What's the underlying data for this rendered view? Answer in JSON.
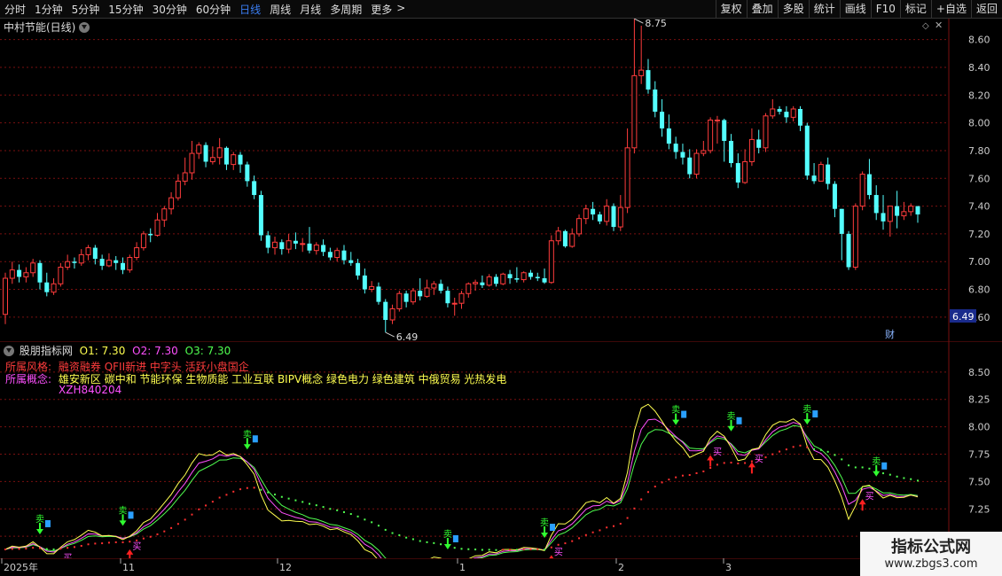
{
  "toolbar": {
    "periods": [
      "分时",
      "1分钟",
      "5分钟",
      "15分钟",
      "30分钟",
      "60分钟",
      "日线",
      "周线",
      "月线",
      "多周期",
      "更多"
    ],
    "active_index": 6,
    "more_arrow": ">",
    "right_buttons": [
      "复权",
      "叠加",
      "多股",
      "统计",
      "画线",
      "F10",
      "标记",
      "+自选",
      "返回"
    ]
  },
  "main_panel": {
    "title": "中村节能(日线)",
    "price_axis": [
      "8.60",
      "8.40",
      "8.20",
      "8.00",
      "7.80",
      "7.60",
      "7.40",
      "7.20",
      "7.00",
      "6.80",
      "6.60"
    ],
    "current_price": "6.49",
    "high_label": "8.75",
    "low_label": "6.49",
    "cai_badge": "财",
    "colors": {
      "up": "#ff3c3c",
      "down": "#54ffff",
      "grid": "#7a1010"
    },
    "candles": [
      [
        6.62,
        6.88,
        6.92,
        6.55
      ],
      [
        6.88,
        6.94,
        7.0,
        6.84
      ],
      [
        6.94,
        6.89,
        6.98,
        6.85
      ],
      [
        6.89,
        6.92,
        6.96,
        6.85
      ],
      [
        6.92,
        6.99,
        7.02,
        6.89
      ],
      [
        6.99,
        6.85,
        7.01,
        6.8
      ],
      [
        6.85,
        6.78,
        6.92,
        6.75
      ],
      [
        6.78,
        6.84,
        6.88,
        6.76
      ],
      [
        6.84,
        6.96,
        6.99,
        6.82
      ],
      [
        6.96,
        7.0,
        7.05,
        6.94
      ],
      [
        7.0,
        6.99,
        7.03,
        6.95
      ],
      [
        6.99,
        7.05,
        7.09,
        6.97
      ],
      [
        7.05,
        7.1,
        7.12,
        7.01
      ],
      [
        7.1,
        7.02,
        7.12,
        6.98
      ],
      [
        7.02,
        6.97,
        7.05,
        6.94
      ],
      [
        6.97,
        7.01,
        7.06,
        6.96
      ],
      [
        7.01,
        6.99,
        7.04,
        6.94
      ],
      [
        6.99,
        6.94,
        7.03,
        6.91
      ],
      [
        6.94,
        7.03,
        7.05,
        6.92
      ],
      [
        7.03,
        7.1,
        7.14,
        7.01
      ],
      [
        7.1,
        7.2,
        7.22,
        7.08
      ],
      [
        7.2,
        7.19,
        7.24,
        7.14
      ],
      [
        7.19,
        7.3,
        7.35,
        7.18
      ],
      [
        7.3,
        7.38,
        7.4,
        7.25
      ],
      [
        7.38,
        7.46,
        7.5,
        7.34
      ],
      [
        7.46,
        7.58,
        7.63,
        7.44
      ],
      [
        7.58,
        7.64,
        7.75,
        7.55
      ],
      [
        7.64,
        7.78,
        7.87,
        7.59
      ],
      [
        7.78,
        7.84,
        7.86,
        7.74
      ],
      [
        7.84,
        7.72,
        7.86,
        7.68
      ],
      [
        7.72,
        7.75,
        7.83,
        7.7
      ],
      [
        7.75,
        7.82,
        7.89,
        7.7
      ],
      [
        7.82,
        7.7,
        7.83,
        7.66
      ],
      [
        7.7,
        7.77,
        7.79,
        7.66
      ],
      [
        7.77,
        7.7,
        7.79,
        7.64
      ],
      [
        7.7,
        7.58,
        7.72,
        7.54
      ],
      [
        7.58,
        7.48,
        7.62,
        7.45
      ],
      [
        7.48,
        7.19,
        7.51,
        7.15
      ],
      [
        7.19,
        7.1,
        7.22,
        7.06
      ],
      [
        7.1,
        7.14,
        7.18,
        7.05
      ],
      [
        7.14,
        7.09,
        7.16,
        7.05
      ],
      [
        7.09,
        7.15,
        7.2,
        7.06
      ],
      [
        7.15,
        7.13,
        7.21,
        7.09
      ],
      [
        7.13,
        7.13,
        7.17,
        7.07
      ],
      [
        7.13,
        7.08,
        7.25,
        7.06
      ],
      [
        7.08,
        7.12,
        7.14,
        7.05
      ],
      [
        7.12,
        7.07,
        7.16,
        7.04
      ],
      [
        7.07,
        7.03,
        7.1,
        7.01
      ],
      [
        7.03,
        7.08,
        7.1,
        7.0
      ],
      [
        7.08,
        7.01,
        7.12,
        6.98
      ],
      [
        7.01,
        6.99,
        7.07,
        6.97
      ],
      [
        6.99,
        6.9,
        7.02,
        6.87
      ],
      [
        6.9,
        6.8,
        6.95,
        6.77
      ],
      [
        6.8,
        6.82,
        6.86,
        6.78
      ],
      [
        6.82,
        6.71,
        6.85,
        6.69
      ],
      [
        6.71,
        6.58,
        6.73,
        6.49
      ],
      [
        6.58,
        6.66,
        6.69,
        6.55
      ],
      [
        6.66,
        6.77,
        6.79,
        6.64
      ],
      [
        6.77,
        6.71,
        6.79,
        6.67
      ],
      [
        6.71,
        6.79,
        6.81,
        6.69
      ],
      [
        6.79,
        6.75,
        6.88,
        6.72
      ],
      [
        6.75,
        6.81,
        6.87,
        6.74
      ],
      [
        6.81,
        6.84,
        6.86,
        6.76
      ],
      [
        6.84,
        6.79,
        6.87,
        6.77
      ],
      [
        6.79,
        6.7,
        6.82,
        6.67
      ],
      [
        6.7,
        6.7,
        6.74,
        6.61
      ],
      [
        6.7,
        6.77,
        6.79,
        6.66
      ],
      [
        6.77,
        6.84,
        6.85,
        6.74
      ],
      [
        6.84,
        6.85,
        6.87,
        6.79
      ],
      [
        6.85,
        6.83,
        6.9,
        6.81
      ],
      [
        6.83,
        6.89,
        6.91,
        6.82
      ],
      [
        6.89,
        6.84,
        6.91,
        6.82
      ],
      [
        6.84,
        6.91,
        6.92,
        6.83
      ],
      [
        6.91,
        6.88,
        6.94,
        6.84
      ],
      [
        6.88,
        6.87,
        6.96,
        6.85
      ],
      [
        6.87,
        6.92,
        6.93,
        6.85
      ],
      [
        6.92,
        6.89,
        6.94,
        6.87
      ],
      [
        6.89,
        6.88,
        6.92,
        6.86
      ],
      [
        6.88,
        6.85,
        6.95,
        6.84
      ],
      [
        6.85,
        7.15,
        7.19,
        6.84
      ],
      [
        7.15,
        7.22,
        7.25,
        7.12
      ],
      [
        7.22,
        7.11,
        7.23,
        7.1
      ],
      [
        7.11,
        7.2,
        7.24,
        7.1
      ],
      [
        7.2,
        7.31,
        7.34,
        7.18
      ],
      [
        7.31,
        7.38,
        7.41,
        7.27
      ],
      [
        7.38,
        7.34,
        7.43,
        7.3
      ],
      [
        7.34,
        7.29,
        7.36,
        7.27
      ],
      [
        7.29,
        7.4,
        7.45,
        7.26
      ],
      [
        7.4,
        7.25,
        7.42,
        7.22
      ],
      [
        7.25,
        7.39,
        7.48,
        7.22
      ],
      [
        7.39,
        7.82,
        7.96,
        7.35
      ],
      [
        7.82,
        8.34,
        8.75,
        7.78
      ],
      [
        8.34,
        8.38,
        8.7,
        8.28
      ],
      [
        8.38,
        8.24,
        8.46,
        8.21
      ],
      [
        8.24,
        8.08,
        8.3,
        8.04
      ],
      [
        8.08,
        7.96,
        8.17,
        7.9
      ],
      [
        7.96,
        7.85,
        8.06,
        7.81
      ],
      [
        7.85,
        7.79,
        7.9,
        7.74
      ],
      [
        7.79,
        7.75,
        7.85,
        7.7
      ],
      [
        7.75,
        7.63,
        7.81,
        7.6
      ],
      [
        7.63,
        7.78,
        7.81,
        7.6
      ],
      [
        7.78,
        7.8,
        7.87,
        7.76
      ],
      [
        7.8,
        8.02,
        8.04,
        7.78
      ],
      [
        8.02,
        8.02,
        8.05,
        7.85
      ],
      [
        8.02,
        7.87,
        8.03,
        7.72
      ],
      [
        7.87,
        7.71,
        7.92,
        7.68
      ],
      [
        7.71,
        7.57,
        7.78,
        7.53
      ],
      [
        7.57,
        7.72,
        7.81,
        7.56
      ],
      [
        7.72,
        7.88,
        7.96,
        7.69
      ],
      [
        7.88,
        7.82,
        7.95,
        7.78
      ],
      [
        7.82,
        8.05,
        8.07,
        7.79
      ],
      [
        8.05,
        8.1,
        8.17,
        8.03
      ],
      [
        8.1,
        8.08,
        8.12,
        8.06
      ],
      [
        8.08,
        8.04,
        8.12,
        8.0
      ],
      [
        8.04,
        8.1,
        8.12,
        8.01
      ],
      [
        8.1,
        7.98,
        8.12,
        7.94
      ],
      [
        7.98,
        7.62,
        8.0,
        7.59
      ],
      [
        7.62,
        7.58,
        7.71,
        7.56
      ],
      [
        7.58,
        7.7,
        7.72,
        7.58
      ],
      [
        7.7,
        7.56,
        7.75,
        7.52
      ],
      [
        7.56,
        7.38,
        7.58,
        7.32
      ],
      [
        7.38,
        7.2,
        7.38,
        7.01
      ],
      [
        7.2,
        6.96,
        7.22,
        6.94
      ],
      [
        6.96,
        7.4,
        7.42,
        6.94
      ],
      [
        7.4,
        7.63,
        7.65,
        7.37
      ],
      [
        7.63,
        7.48,
        7.74,
        7.45
      ],
      [
        7.48,
        7.35,
        7.55,
        7.3
      ],
      [
        7.35,
        7.29,
        7.48,
        7.23
      ],
      [
        7.29,
        7.4,
        7.4,
        7.18
      ],
      [
        7.4,
        7.33,
        7.51,
        7.24
      ],
      [
        7.33,
        7.36,
        7.43,
        7.3
      ],
      [
        7.36,
        7.4,
        7.42,
        7.33
      ],
      [
        7.4,
        7.34,
        7.39,
        7.28
      ]
    ]
  },
  "indicator_panel": {
    "title": "股朋指标网",
    "o1": "O1: 7.30",
    "o2": "O2: 7.30",
    "o3": "O3: 7.30",
    "style_label": "所属风格:",
    "style_value": "融资融券 QFII新进 中字头 活跃小盘国企",
    "concept_label": "所属概念:",
    "concept_value": "雄安新区 碳中和 节能环保 生物质能 工业互联 BIPV概念 绿色电力 绿色建筑 中俄贸易 光热发电",
    "code": "XZH840204",
    "axis": [
      "8.50",
      "8.25",
      "8.00",
      "7.75",
      "7.50",
      "7.25",
      "7.00"
    ],
    "buy_mark": "买",
    "sell_mark": "卖",
    "colors": {
      "o1": "#ffff50",
      "o2": "#ff50ff",
      "o3": "#50ff50",
      "dots_red": "#ff3030",
      "dots_green": "#50ff50"
    }
  },
  "date_axis": [
    "2025年",
    "11",
    "12",
    "1",
    "2",
    "3"
  ],
  "watermark": {
    "title": "指标公式网",
    "url": "www.zbgs3.com"
  }
}
